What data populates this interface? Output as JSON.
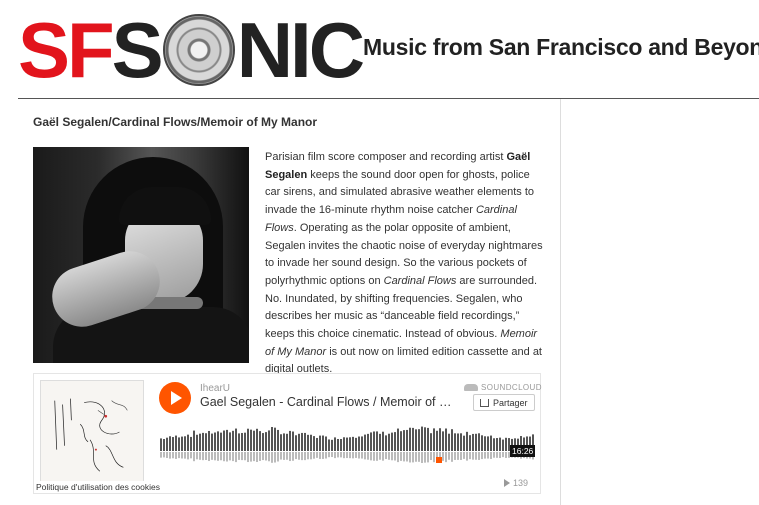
{
  "site": {
    "logo_left": "SF",
    "logo_s": "S",
    "logo_right": "NIC",
    "tagline": "Music from San Francisco and Beyond"
  },
  "post": {
    "title": "Gaël Segalen/Cardinal Flows/Memoir of My Manor",
    "paragraph": [
      {
        "t": "Parisian film score composer and recording artist "
      },
      {
        "b": "Gaël Segalen"
      },
      {
        "t": "  keeps the sound door open for ghosts, police car sirens, and simulated abrasive weather elements to invade the 16-minute rhythm noise catcher "
      },
      {
        "i": "Cardinal Flows"
      },
      {
        "t": ". Operating as the polar opposite of ambient, Segalen invites the chaotic noise of everyday nightmares to invade her sound design. So the various pockets of polyrhythmic options on "
      },
      {
        "i": "Cardinal Flows"
      },
      {
        "t": " are surrounded. No. Inundated, by shifting frequencies. Segalen, who describes her music as “danceable field recordings,” keeps this choice cinematic. Instead of obvious. "
      },
      {
        "i": "Memoir of My Manor"
      },
      {
        "t": " is out now on limited edition cassette and at digital outlets."
      }
    ]
  },
  "player": {
    "user": "IhearU",
    "track": "Gael Segalen - Cardinal Flows / Memoir of My Manor",
    "brand": "SOUNDCLOUD",
    "share_label": "Partager",
    "duration": "16:26",
    "plays": "139",
    "cookie_notice": "Politique d'utilisation des cookies",
    "accent_color": "#ff5500",
    "icons": [
      "play-icon",
      "soundcloud-icon",
      "share-icon",
      "plays-icon"
    ]
  }
}
